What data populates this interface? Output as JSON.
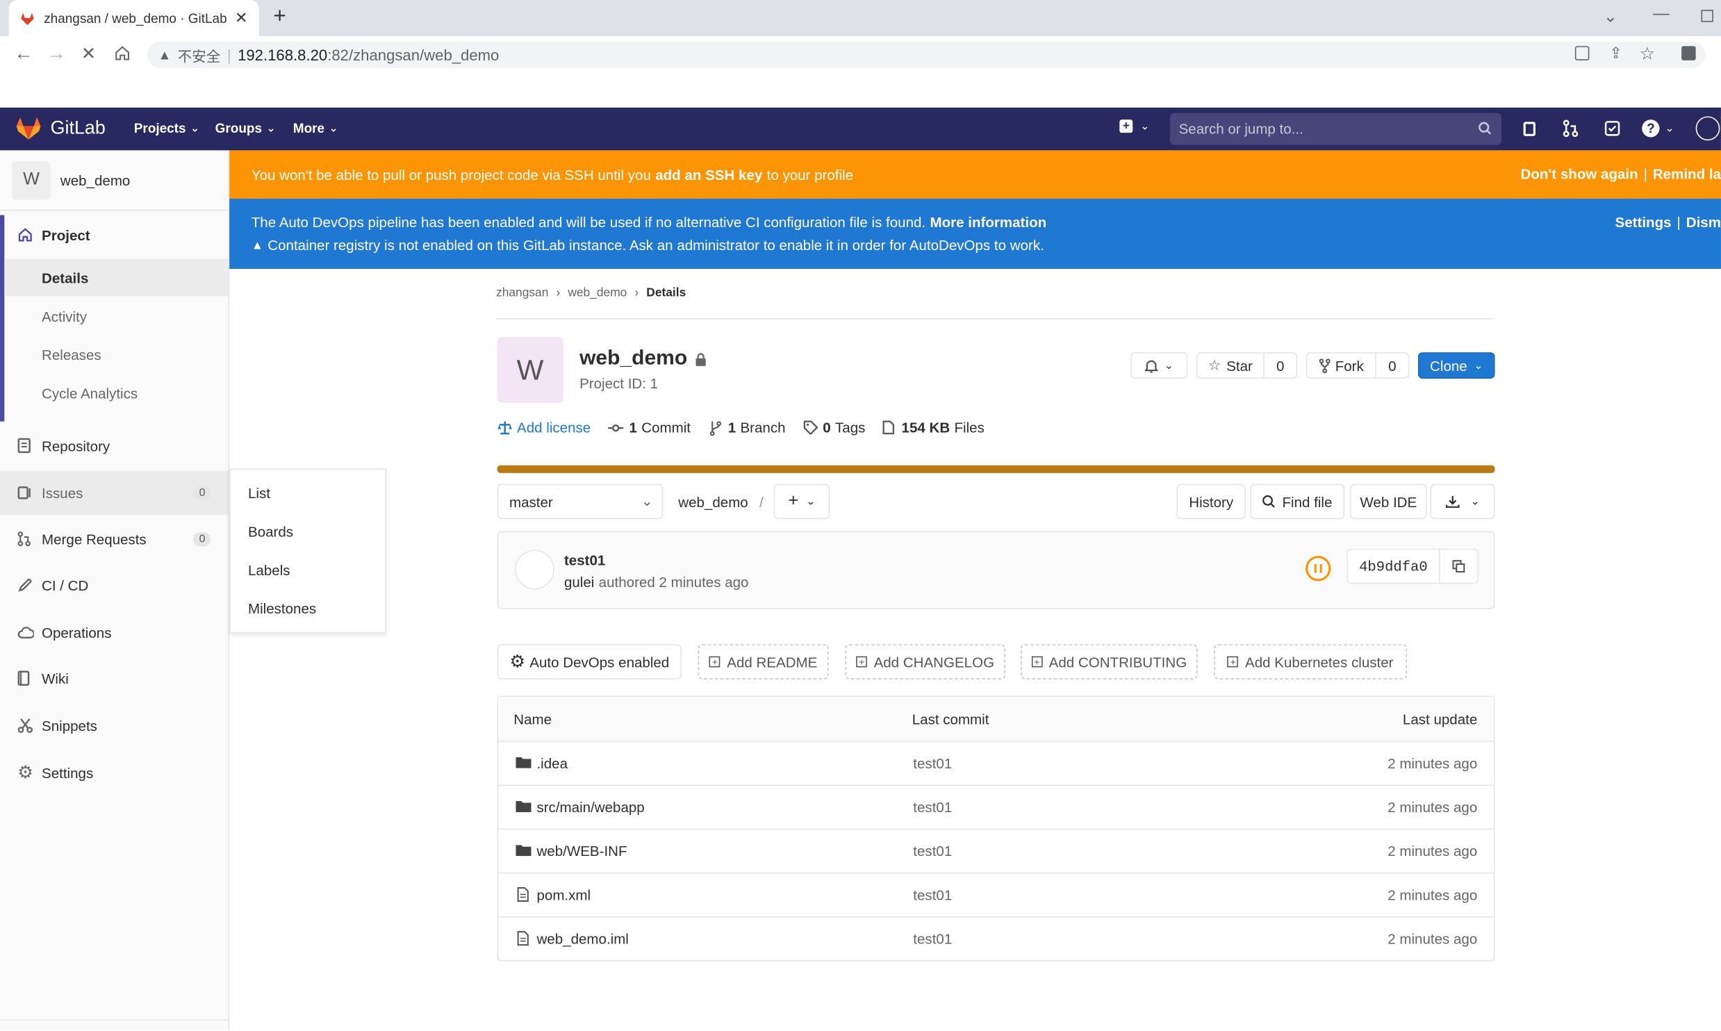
{
  "browser": {
    "tab_title": "zhangsan / web_demo · GitLab",
    "new_tab": "+",
    "security_label": "不安全",
    "url_host": "192.168.8.20",
    "url_rest": ":82/zhangsan/web_demo"
  },
  "navbar": {
    "brand": "GitLab",
    "projects": "Projects",
    "groups": "Groups",
    "more": "More",
    "search_placeholder": "Search or jump to..."
  },
  "sidebar": {
    "project_avatar": "W",
    "project_name": "web_demo",
    "project": "Project",
    "details": "Details",
    "activity": "Activity",
    "releases": "Releases",
    "cycle_analytics": "Cycle Analytics",
    "repository": "Repository",
    "issues": "Issues",
    "issues_count": "0",
    "merge_requests": "Merge Requests",
    "mr_count": "0",
    "cicd": "CI / CD",
    "operations": "Operations",
    "wiki": "Wiki",
    "snippets": "Snippets",
    "settings": "Settings"
  },
  "flyout": {
    "list": "List",
    "boards": "Boards",
    "labels": "Labels",
    "milestones": "Milestones"
  },
  "ssh_banner": {
    "text_pre": "You won't be able to pull or push project code via SSH until you",
    "link": "add an SSH key",
    "text_post": "to your profile",
    "dont_show": "Don't show again",
    "separator": "|",
    "remind": "Remind la"
  },
  "devops_banner": {
    "line1": "The Auto DevOps pipeline has been enabled and will be used if no alternative CI configuration file is found.",
    "more_info": "More information",
    "line2": "Container registry is not enabled on this GitLab instance. Ask an administrator to enable it in order for AutoDevOps to work.",
    "settings": "Settings",
    "separator": "|",
    "dismiss": "Dism"
  },
  "breadcrumb": {
    "user": "zhangsan",
    "project": "web_demo",
    "current": "Details"
  },
  "project": {
    "avatar": "W",
    "name": "web_demo",
    "id_label": "Project ID: 1",
    "star": "Star",
    "star_count": "0",
    "fork": "Fork",
    "fork_count": "0",
    "clone": "Clone"
  },
  "stats": {
    "add_license": "Add license",
    "commits_num": "1",
    "commits_label": "Commit",
    "branches_num": "1",
    "branches_label": "Branch",
    "tags_num": "0",
    "tags_label": "Tags",
    "files_size": "154 KB",
    "files_label": "Files"
  },
  "toolbar": {
    "branch": "master",
    "path": "web_demo",
    "slash": "/",
    "plus": "+",
    "history": "History",
    "find_file": "Find file",
    "web_ide": "Web IDE"
  },
  "last_commit": {
    "title": "test01",
    "author": "gulei",
    "meta": "authored 2 minutes ago",
    "sha": "4b9ddfa0"
  },
  "actions": {
    "auto_devops": "Auto DevOps enabled",
    "add_readme": "Add README",
    "add_changelog": "Add CHANGELOG",
    "add_contributing": "Add CONTRIBUTING",
    "add_k8s": "Add Kubernetes cluster"
  },
  "files_table": {
    "headers": [
      "Name",
      "Last commit",
      "Last update"
    ],
    "rows": [
      {
        "name": ".idea",
        "type": "folder",
        "commit": "test01",
        "updated": "2 minutes ago"
      },
      {
        "name": "src/main/webapp",
        "type": "folder",
        "commit": "test01",
        "updated": "2 minutes ago"
      },
      {
        "name": "web/WEB-INF",
        "type": "folder",
        "commit": "test01",
        "updated": "2 minutes ago"
      },
      {
        "name": "pom.xml",
        "type": "file",
        "commit": "test01",
        "updated": "2 minutes ago"
      },
      {
        "name": "web_demo.iml",
        "type": "file",
        "commit": "test01",
        "updated": "2 minutes ago"
      }
    ]
  },
  "colors": {
    "navbar": "#292961",
    "warning_banner": "#fc9403",
    "info_banner": "#1f78d1",
    "primary": "#1f78d1",
    "progress_bar": "#b97b16"
  },
  "icons": [
    "gitlab-logo",
    "home-icon",
    "book-icon",
    "issues-icon",
    "merge-request-icon",
    "rocket-icon",
    "cloud-icon",
    "wiki-icon",
    "scissors-icon",
    "gear-icon",
    "bell-icon",
    "star-icon",
    "fork-icon",
    "lock-icon",
    "search-icon",
    "folder-icon",
    "file-icon",
    "copy-icon",
    "download-icon",
    "pipeline-paused-icon"
  ]
}
